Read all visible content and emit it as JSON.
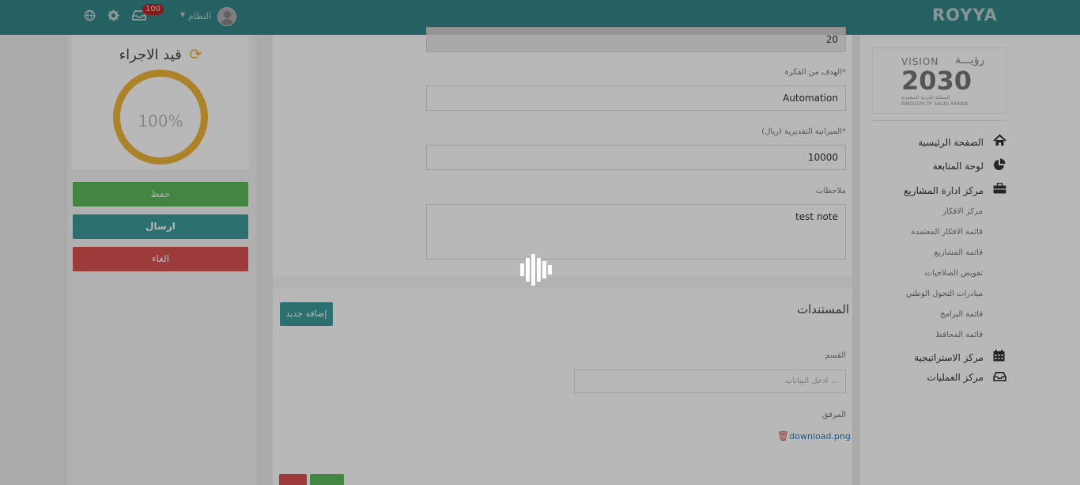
{
  "header": {
    "brand": "ROYYA",
    "notifications_count": "100",
    "user_name": "النظام",
    "icons": [
      "globe-icon",
      "gear-icon",
      "inbox-icon",
      "user-avatar"
    ]
  },
  "status_card": {
    "title": "قيد الاجراء",
    "progress_label": "100%",
    "progress_fraction": 1.0
  },
  "side_buttons": {
    "save": "حفظ",
    "send": "ارسال",
    "cancel": "الغاء"
  },
  "form": {
    "top_value": "20",
    "goal_label": "الهدف من الفكرة*",
    "goal_value": "Automation",
    "budget_label": "الميزانية التقديرية (ريال)*",
    "budget_value": "10000",
    "notes_label": "ملاحظات",
    "notes_value": "test note"
  },
  "documents": {
    "title": "المستندات",
    "add_button": "إضافة جديد",
    "section_label": "القسم",
    "section_placeholder": "ادخل البيانات ...",
    "attachment_label": "المرفق",
    "attachment_file": "download.png"
  },
  "sidebar": {
    "logo": {
      "word": "VISION",
      "arabic": "رؤيـــة",
      "year": "2030",
      "line1": "المملكة العربية السعودية",
      "line2": "KINGDOM OF SAUDI ARABIA"
    },
    "items": [
      {
        "label": "الصفحة الرئيسية",
        "icon": "home-icon"
      },
      {
        "label": "لوحة المتابعة",
        "icon": "pie-chart-icon"
      },
      {
        "label": "مركز ادارة المشاريع",
        "icon": "briefcase-icon"
      }
    ],
    "sub_items": [
      "مركز الافكار",
      "قائمة الافكار المعتمدة",
      "قائمة المشاريع",
      "تفويض الصلاحيات",
      "مبادرات التحول الوطني",
      "قائمة البرامج",
      "قائمة المحافظ"
    ],
    "bottom_items": [
      {
        "label": "مركز الاستراتيجية",
        "icon": "calendar-icon"
      },
      {
        "label": "مركز العمليات",
        "icon": "inbox-icon"
      }
    ]
  },
  "colors": {
    "teal": "#3c9a9b",
    "green": "#5cb85c",
    "red": "#d9534f",
    "orange": "#f0b63a"
  }
}
